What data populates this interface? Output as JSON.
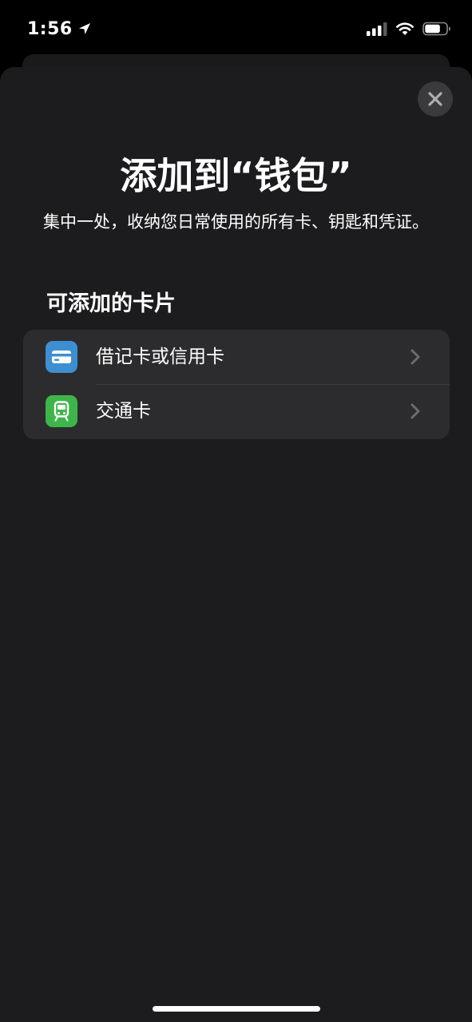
{
  "status_bar": {
    "time": "1:56",
    "icons": [
      "location-arrow-icon",
      "cellular-signal-icon",
      "wifi-icon",
      "battery-icon"
    ],
    "battery_level": 0.7
  },
  "sheet": {
    "close_icon": "close-icon",
    "title": "添加到“钱包”",
    "subtitle": "集中一处，收纳您日常使用的所有卡、钥匙和凭证。",
    "section_header": "可添加的卡片",
    "items": [
      {
        "label": "借记卡或信用卡",
        "icon": "credit-card-icon",
        "icon_color": "#3d8fd1"
      },
      {
        "label": "交通卡",
        "icon": "train-icon",
        "icon_color": "#3eb54a"
      }
    ]
  },
  "colors": {
    "background": "#000000",
    "sheet": "#1c1c1e",
    "list_background": "#2c2c2e",
    "close_button": "#3a3a3c",
    "chevron": "#6b6b70"
  }
}
